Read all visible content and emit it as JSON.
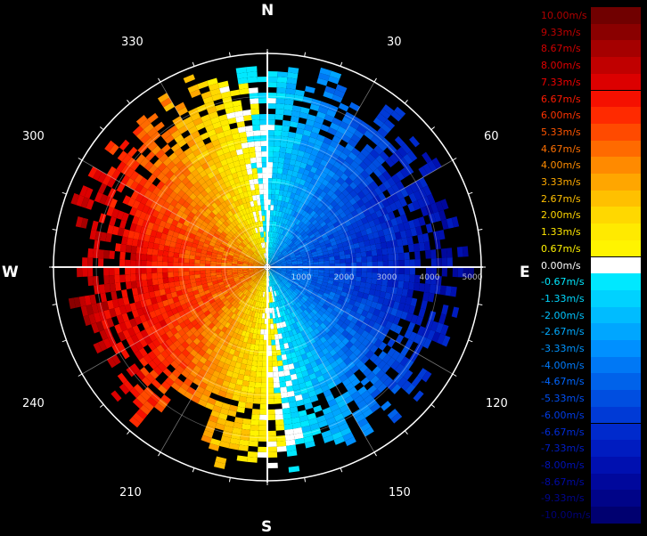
{
  "compass": {
    "north": "N",
    "south": "S",
    "east": "E",
    "west": "W"
  },
  "azimuth_labels": [
    "30",
    "60",
    "120",
    "150",
    "210",
    "240",
    "300",
    "330"
  ],
  "range_labels": [
    "1000",
    "2000",
    "3000",
    "4000",
    "5000"
  ],
  "legend": [
    {
      "label": "10.00m/s",
      "color": "#700000",
      "text_color": "#b00000"
    },
    {
      "label": "9.33m/s",
      "color": "#8a0000",
      "text_color": "#c00000"
    },
    {
      "label": "8.67m/s",
      "color": "#a50000",
      "text_color": "#d00000"
    },
    {
      "label": "8.00m/s",
      "color": "#c00000",
      "text_color": "#e00000"
    },
    {
      "label": "7.33m/s",
      "color": "#dc0000",
      "text_color": "#f00000"
    },
    {
      "label": "6.67m/s",
      "color": "#f51000",
      "text_color": "#ff1a00"
    },
    {
      "label": "6.00m/s",
      "color": "#ff2a00",
      "text_color": "#ff3300"
    },
    {
      "label": "5.33m/s",
      "color": "#ff4a00",
      "text_color": "#ff5500"
    },
    {
      "label": "4.67m/s",
      "color": "#ff6a00",
      "text_color": "#ff7000"
    },
    {
      "label": "4.00m/s",
      "color": "#ff8a00",
      "text_color": "#ff8c00"
    },
    {
      "label": "3.33m/s",
      "color": "#ffa600",
      "text_color": "#ffaa00"
    },
    {
      "label": "2.67m/s",
      "color": "#ffc000",
      "text_color": "#ffc000"
    },
    {
      "label": "2.00m/s",
      "color": "#ffd800",
      "text_color": "#ffd500"
    },
    {
      "label": "1.33m/s",
      "color": "#ffea00",
      "text_color": "#ffe600"
    },
    {
      "label": "0.67m/s",
      "color": "#fff400",
      "text_color": "#fff200"
    },
    {
      "label": "0.00m/s",
      "color": "#ffffff",
      "text_color": "#ffffff"
    },
    {
      "label": "-0.67m/s",
      "color": "#00e8ff",
      "text_color": "#00e8ff"
    },
    {
      "label": "-1.33m/s",
      "color": "#00d2ff",
      "text_color": "#00d8ff"
    },
    {
      "label": "-2.00m/s",
      "color": "#00bcff",
      "text_color": "#00c4ff"
    },
    {
      "label": "-2.67m/s",
      "color": "#00a6ff",
      "text_color": "#00aaff"
    },
    {
      "label": "-3.33m/s",
      "color": "#0090ff",
      "text_color": "#0094ff"
    },
    {
      "label": "-4.00m/s",
      "color": "#0078f5",
      "text_color": "#007cff"
    },
    {
      "label": "-4.67m/s",
      "color": "#0062ea",
      "text_color": "#0066ff"
    },
    {
      "label": "-5.33m/s",
      "color": "#004ee0",
      "text_color": "#0050f5"
    },
    {
      "label": "-6.00m/s",
      "color": "#003ad6",
      "text_color": "#003ce8"
    },
    {
      "label": "-6.67m/s",
      "color": "#002acc",
      "text_color": "#002cd8"
    },
    {
      "label": "-7.33m/s",
      "color": "#001cc0",
      "text_color": "#001ec8"
    },
    {
      "label": "-8.00m/s",
      "color": "#0010b0",
      "text_color": "#0012b8"
    },
    {
      "label": "-8.67m/s",
      "color": "#00089c",
      "text_color": "#000aa4"
    },
    {
      "label": "-9.33m/s",
      "color": "#000488",
      "text_color": "#00068c"
    },
    {
      "label": "-10.00m/s",
      "color": "#000070",
      "text_color": "#000078"
    }
  ]
}
